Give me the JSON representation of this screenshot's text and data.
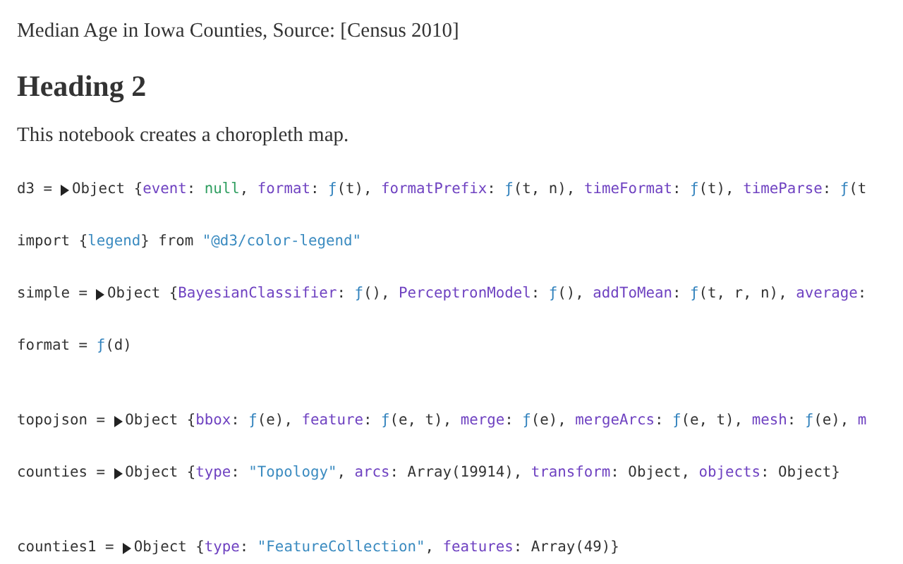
{
  "caption": "Median Age in Iowa Counties, Source: [Census 2010]",
  "heading": "Heading 2",
  "intro": "This notebook creates a choropleth map.",
  "cells": [
    {
      "label": "d3 =",
      "expandable": true,
      "tokens": [
        {
          "kind": "plain",
          "text": "Object {"
        },
        {
          "kind": "key",
          "text": "event"
        },
        {
          "kind": "plain",
          "text": ": "
        },
        {
          "kind": "null",
          "text": "null"
        },
        {
          "kind": "plain",
          "text": ", "
        },
        {
          "kind": "key",
          "text": "format"
        },
        {
          "kind": "plain",
          "text": ": "
        },
        {
          "kind": "fn",
          "text": "ƒ"
        },
        {
          "kind": "plain",
          "text": "(t), "
        },
        {
          "kind": "key",
          "text": "formatPrefix"
        },
        {
          "kind": "plain",
          "text": ": "
        },
        {
          "kind": "fn",
          "text": "ƒ"
        },
        {
          "kind": "plain",
          "text": "(t, n), "
        },
        {
          "kind": "key",
          "text": "timeFormat"
        },
        {
          "kind": "plain",
          "text": ": "
        },
        {
          "kind": "fn",
          "text": "ƒ"
        },
        {
          "kind": "plain",
          "text": "(t), "
        },
        {
          "kind": "key",
          "text": "timeParse"
        },
        {
          "kind": "plain",
          "text": ": "
        },
        {
          "kind": "fn",
          "text": "ƒ"
        },
        {
          "kind": "plain",
          "text": "(t"
        }
      ]
    },
    {
      "label": "import",
      "expandable": false,
      "tokens": [
        {
          "kind": "plain",
          "text": "{"
        },
        {
          "kind": "str",
          "text": "legend"
        },
        {
          "kind": "plain",
          "text": "} from "
        },
        {
          "kind": "str",
          "text": "\"@d3/color-legend\""
        }
      ]
    },
    {
      "label": "simple =",
      "expandable": true,
      "tokens": [
        {
          "kind": "plain",
          "text": "Object {"
        },
        {
          "kind": "key",
          "text": "BayesianClassifier"
        },
        {
          "kind": "plain",
          "text": ": "
        },
        {
          "kind": "fn",
          "text": "ƒ"
        },
        {
          "kind": "plain",
          "text": "(), "
        },
        {
          "kind": "key",
          "text": "PerceptronModel"
        },
        {
          "kind": "plain",
          "text": ": "
        },
        {
          "kind": "fn",
          "text": "ƒ"
        },
        {
          "kind": "plain",
          "text": "(), "
        },
        {
          "kind": "key",
          "text": "addToMean"
        },
        {
          "kind": "plain",
          "text": ": "
        },
        {
          "kind": "fn",
          "text": "ƒ"
        },
        {
          "kind": "plain",
          "text": "(t, r, n), "
        },
        {
          "kind": "key",
          "text": "average"
        },
        {
          "kind": "plain",
          "text": ":"
        }
      ]
    },
    {
      "label": "format =",
      "expandable": false,
      "tokens": [
        {
          "kind": "fn",
          "text": "ƒ"
        },
        {
          "kind": "plain",
          "text": "(d)"
        }
      ]
    },
    {
      "label": "topojson =",
      "expandable": true,
      "tokens": [
        {
          "kind": "plain",
          "text": "Object {"
        },
        {
          "kind": "key",
          "text": "bbox"
        },
        {
          "kind": "plain",
          "text": ": "
        },
        {
          "kind": "fn",
          "text": "ƒ"
        },
        {
          "kind": "plain",
          "text": "(e), "
        },
        {
          "kind": "key",
          "text": "feature"
        },
        {
          "kind": "plain",
          "text": ": "
        },
        {
          "kind": "fn",
          "text": "ƒ"
        },
        {
          "kind": "plain",
          "text": "(e, t), "
        },
        {
          "kind": "key",
          "text": "merge"
        },
        {
          "kind": "plain",
          "text": ": "
        },
        {
          "kind": "fn",
          "text": "ƒ"
        },
        {
          "kind": "plain",
          "text": "(e), "
        },
        {
          "kind": "key",
          "text": "mergeArcs"
        },
        {
          "kind": "plain",
          "text": ": "
        },
        {
          "kind": "fn",
          "text": "ƒ"
        },
        {
          "kind": "plain",
          "text": "(e, t), "
        },
        {
          "kind": "key",
          "text": "mesh"
        },
        {
          "kind": "plain",
          "text": ": "
        },
        {
          "kind": "fn",
          "text": "ƒ"
        },
        {
          "kind": "plain",
          "text": "(e), "
        },
        {
          "kind": "key",
          "text": "m"
        }
      ]
    },
    {
      "label": "counties =",
      "expandable": true,
      "tokens": [
        {
          "kind": "plain",
          "text": "Object {"
        },
        {
          "kind": "key",
          "text": "type"
        },
        {
          "kind": "plain",
          "text": ": "
        },
        {
          "kind": "str",
          "text": "\"Topology\""
        },
        {
          "kind": "plain",
          "text": ", "
        },
        {
          "kind": "key",
          "text": "arcs"
        },
        {
          "kind": "plain",
          "text": ": Array(19914), "
        },
        {
          "kind": "key",
          "text": "transform"
        },
        {
          "kind": "plain",
          "text": ": Object, "
        },
        {
          "kind": "key",
          "text": "objects"
        },
        {
          "kind": "plain",
          "text": ": Object}"
        }
      ]
    },
    {
      "label": "counties1 =",
      "expandable": true,
      "tokens": [
        {
          "kind": "plain",
          "text": "Object {"
        },
        {
          "kind": "key",
          "text": "type"
        },
        {
          "kind": "plain",
          "text": ": "
        },
        {
          "kind": "str",
          "text": "\"FeatureCollection\""
        },
        {
          "kind": "plain",
          "text": ", "
        },
        {
          "kind": "key",
          "text": "features"
        },
        {
          "kind": "plain",
          "text": ": Array(49)}"
        }
      ]
    }
  ]
}
